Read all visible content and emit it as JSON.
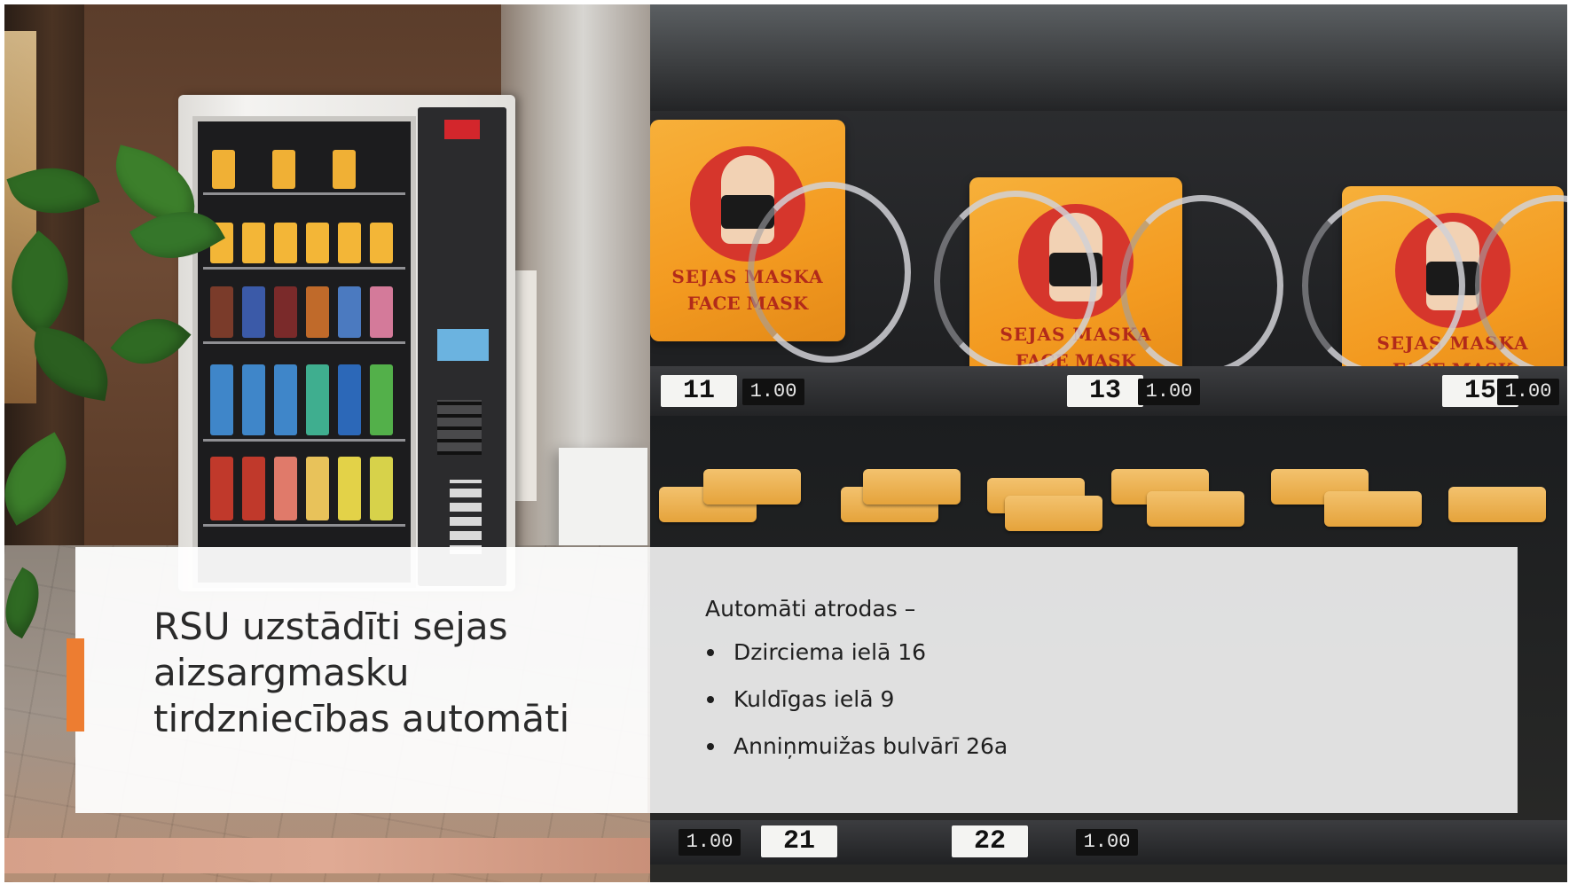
{
  "slide": {
    "title": "RSU uzstādīti sejas\naizsargmasku\ntirdzniecības automāti",
    "intro": "Automāti atrodas –",
    "locations": [
      "Dzirciema ielā 16",
      "Kuldīgas ielā 9",
      "Anniņmuižas bulvārī 26a"
    ],
    "accent_color": "#ed7d31"
  },
  "photo_right": {
    "pack_title": "SEJAS MASKA",
    "pack_subtitle": "FACE MASK",
    "slots": [
      {
        "number": "11",
        "price": "1.00"
      },
      {
        "number": "13",
        "price": "1.00"
      },
      {
        "number": "15",
        "price": "1.00"
      }
    ],
    "lower_slots": [
      {
        "number": "21",
        "price": "1.00"
      },
      {
        "number": "22",
        "price": "1.00"
      }
    ]
  }
}
